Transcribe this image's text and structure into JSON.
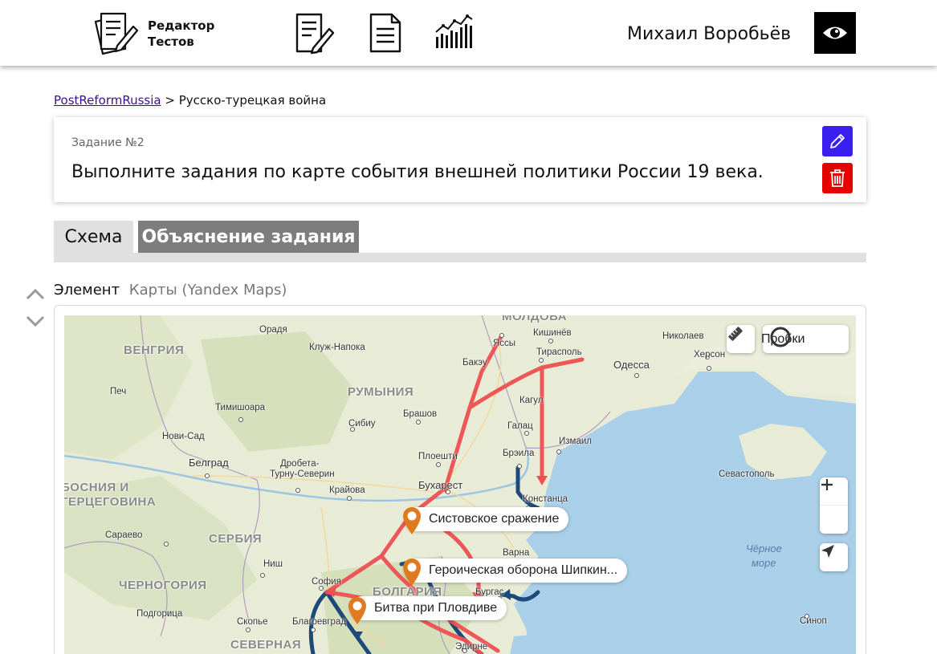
{
  "header": {
    "logo_line1": "Редактор",
    "logo_line2": "Тестов",
    "user_name": "Михаил Воробьёв",
    "icons": [
      "editor-logo-icon",
      "edit-document-icon",
      "document-icon",
      "statistics-icon",
      "eye-icon"
    ]
  },
  "breadcrumb": {
    "course": "PostReformRussia",
    "separator": ">",
    "topic": "Русско-турецкая война"
  },
  "task": {
    "number": "Задание №2",
    "title": "Выполните задания по карте события внешней политики России 19 века."
  },
  "tabs": [
    {
      "label": "Схема",
      "active": true
    },
    {
      "label": "Объяснение задания",
      "active": false
    }
  ],
  "element": {
    "label": "Элемент",
    "type": "Карты (Yandex Maps)"
  },
  "map": {
    "traffic_label": "Пробки",
    "places": {
      "moldova": "МОЛДОВА",
      "hungary": "ВЕНГРИЯ",
      "romania": "РУМЫНИЯ",
      "bosnia1": "БОСНИЯ И",
      "bosnia2": "ГЕРЦЕГОВИНА",
      "serbia": "СЕРБИЯ",
      "montenegro": "ЧЕРНОГОРИЯ",
      "bulgaria": "БОЛГАРИЯ",
      "north": "СЕВЕРНАЯ",
      "black_sea1": "Чёрное",
      "black_sea2": "море",
      "oradea": "Орадя",
      "cluj": "Клуж-Напока",
      "iasi": "Яссы",
      "chisinau": "Кишинёв",
      "bacau": "Бакэу",
      "tiraspol": "Тирасполь",
      "odessa": "Одесса",
      "nikolaev": "Николаев",
      "kherson": "Херсон",
      "pecs": "Печ",
      "timisoara": "Тимишоара",
      "sibiu": "Сибиу",
      "brasov": "Брашов",
      "cahul": "Кагул",
      "galati": "Галац",
      "izmail": "Измаил",
      "novisad": "Нови-Сад",
      "belgrade": "Белград",
      "drobeta1": "Дробета-",
      "drobeta2": "Турну-Северин",
      "ploiesti": "Плоешти",
      "braila": "Брэила",
      "sevastopol": "Севастополь",
      "craiova": "Крайова",
      "bucharest": "Бухарест",
      "constanta": "Констанца",
      "sarajevo": "Сараево",
      "varna": "Варна",
      "nis": "Ниш",
      "sofia": "София",
      "burgas": "Бургас",
      "podgorica": "Подгорица",
      "skopje": "Скопье",
      "blagoevgrad": "Благоевград",
      "sinop": "Синоп",
      "edirne": "Эдирне"
    },
    "events": [
      {
        "label": "Систовское сражение"
      },
      {
        "label": "Героическая оборона Шипкин..."
      },
      {
        "label": "Битва при Пловдиве"
      }
    ],
    "colors": {
      "russian_route": "#ef5052",
      "turkish_route": "#1d4a7a",
      "pin": "#e07a1f",
      "sea": "#a9cfe9",
      "land": "#e8ecd6"
    }
  }
}
